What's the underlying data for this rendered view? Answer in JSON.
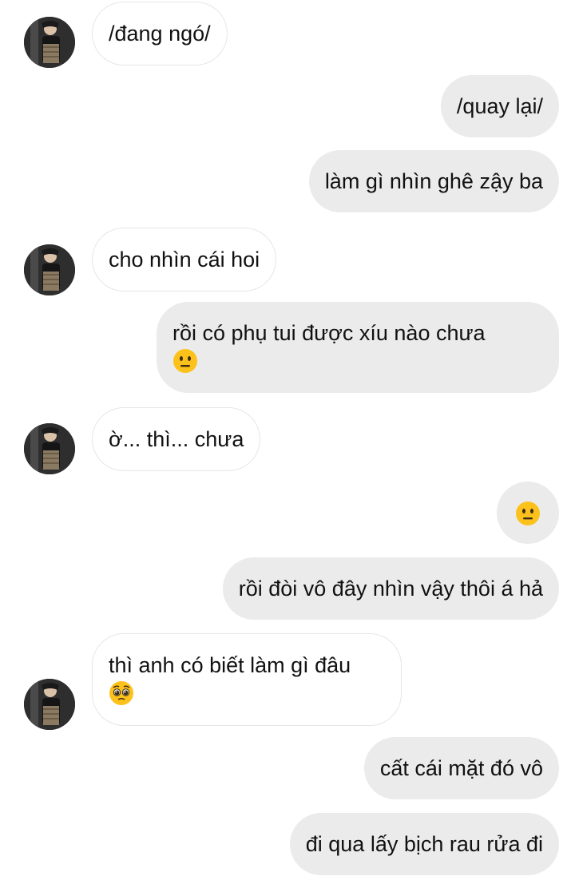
{
  "conversation": {
    "messages": [
      {
        "side": "in",
        "text": "/đang ngó/"
      },
      {
        "side": "out",
        "text": "/quay lại/"
      },
      {
        "side": "out",
        "text": "làm gì nhìn ghê zậy ba"
      },
      {
        "side": "in",
        "text": "cho nhìn cái hoi"
      },
      {
        "side": "out",
        "text": "rồi có phụ tui được xíu nào chưa",
        "emoji": "neutral-face"
      },
      {
        "side": "in",
        "text": "ờ... thì... chưa"
      },
      {
        "side": "out",
        "text": "",
        "emoji": "neutral-face"
      },
      {
        "side": "out",
        "text": "rồi đòi vô đây nhìn vậy thôi á hả"
      },
      {
        "side": "in",
        "text": "thì anh có biết làm gì đâu",
        "emoji": "pleading-face"
      },
      {
        "side": "out",
        "text": "cất cái mặt đó vô"
      },
      {
        "side": "out",
        "text": "đi qua lấy bịch rau rửa đi"
      }
    ]
  },
  "colors": {
    "incoming_bubble": "#ffffff",
    "incoming_border": "#e6e6e6",
    "outgoing_bubble": "#ebebeb",
    "text": "#111111",
    "emoji_yellow": "#fcc21b"
  }
}
